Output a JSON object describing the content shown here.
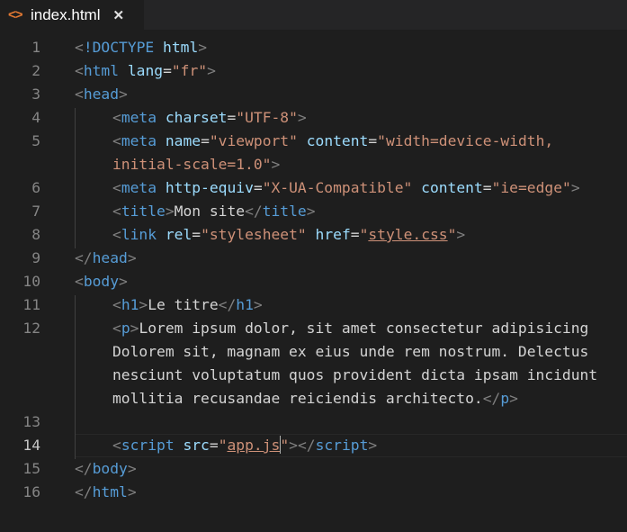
{
  "tab": {
    "icon": "code-brackets-icon",
    "icon_glyph": "<>",
    "filename": "index.html",
    "close_glyph": "✕"
  },
  "colors": {
    "background": "#1e1e1e",
    "tag": "#569cd6",
    "attribute": "#9cdcfe",
    "string": "#ce9178",
    "punctuation": "#808080",
    "text": "#d4d4d4",
    "line_number": "#858585",
    "file_icon": "#e37933"
  },
  "editor": {
    "active_line": "14",
    "lines": [
      {
        "num": "1",
        "indent": 0,
        "tokens": [
          {
            "c": "p",
            "v": "<"
          },
          {
            "c": "t",
            "v": "!DOCTYPE"
          },
          {
            "c": "x",
            "v": " "
          },
          {
            "c": "a",
            "v": "html"
          },
          {
            "c": "p",
            "v": ">"
          }
        ]
      },
      {
        "num": "2",
        "indent": 0,
        "tokens": [
          {
            "c": "p",
            "v": "<"
          },
          {
            "c": "t",
            "v": "html"
          },
          {
            "c": "x",
            "v": " "
          },
          {
            "c": "a",
            "v": "lang"
          },
          {
            "c": "x",
            "v": "="
          },
          {
            "c": "s",
            "v": "\"fr\""
          },
          {
            "c": "p",
            "v": ">"
          }
        ]
      },
      {
        "num": "3",
        "indent": 0,
        "tokens": [
          {
            "c": "p",
            "v": "<"
          },
          {
            "c": "t",
            "v": "head"
          },
          {
            "c": "p",
            "v": ">"
          }
        ]
      },
      {
        "num": "4",
        "indent": 1,
        "tokens": [
          {
            "c": "p",
            "v": "<"
          },
          {
            "c": "t",
            "v": "meta"
          },
          {
            "c": "x",
            "v": " "
          },
          {
            "c": "a",
            "v": "charset"
          },
          {
            "c": "x",
            "v": "="
          },
          {
            "c": "s",
            "v": "\"UTF-8\""
          },
          {
            "c": "p",
            "v": ">"
          }
        ]
      },
      {
        "num": "5",
        "indent": 1,
        "tokens": [
          {
            "c": "p",
            "v": "<"
          },
          {
            "c": "t",
            "v": "meta"
          },
          {
            "c": "x",
            "v": " "
          },
          {
            "c": "a",
            "v": "name"
          },
          {
            "c": "x",
            "v": "="
          },
          {
            "c": "s",
            "v": "\"viewport\""
          },
          {
            "c": "x",
            "v": " "
          },
          {
            "c": "a",
            "v": "content"
          },
          {
            "c": "x",
            "v": "="
          },
          {
            "c": "s",
            "v": "\"width=device-width,"
          }
        ]
      },
      {
        "num": "",
        "indent": 1,
        "tokens": [
          {
            "c": "s",
            "v": "initial-scale=1.0\""
          },
          {
            "c": "p",
            "v": ">"
          }
        ]
      },
      {
        "num": "6",
        "indent": 1,
        "tokens": [
          {
            "c": "p",
            "v": "<"
          },
          {
            "c": "t",
            "v": "meta"
          },
          {
            "c": "x",
            "v": " "
          },
          {
            "c": "a",
            "v": "http-equiv"
          },
          {
            "c": "x",
            "v": "="
          },
          {
            "c": "s",
            "v": "\"X-UA-Compatible\""
          },
          {
            "c": "x",
            "v": " "
          },
          {
            "c": "a",
            "v": "content"
          },
          {
            "c": "x",
            "v": "="
          },
          {
            "c": "s",
            "v": "\"ie=edge\""
          },
          {
            "c": "p",
            "v": ">"
          }
        ]
      },
      {
        "num": "7",
        "indent": 1,
        "tokens": [
          {
            "c": "p",
            "v": "<"
          },
          {
            "c": "t",
            "v": "title"
          },
          {
            "c": "p",
            "v": ">"
          },
          {
            "c": "x",
            "v": "Mon site"
          },
          {
            "c": "p",
            "v": "</"
          },
          {
            "c": "t",
            "v": "title"
          },
          {
            "c": "p",
            "v": ">"
          }
        ]
      },
      {
        "num": "8",
        "indent": 1,
        "tokens": [
          {
            "c": "p",
            "v": "<"
          },
          {
            "c": "t",
            "v": "link"
          },
          {
            "c": "x",
            "v": " "
          },
          {
            "c": "a",
            "v": "rel"
          },
          {
            "c": "x",
            "v": "="
          },
          {
            "c": "s",
            "v": "\"stylesheet\""
          },
          {
            "c": "x",
            "v": " "
          },
          {
            "c": "a",
            "v": "href"
          },
          {
            "c": "x",
            "v": "="
          },
          {
            "c": "s",
            "v": "\""
          },
          {
            "c": "s u",
            "v": "style.css"
          },
          {
            "c": "s",
            "v": "\""
          },
          {
            "c": "p",
            "v": ">"
          }
        ]
      },
      {
        "num": "9",
        "indent": 0,
        "tokens": [
          {
            "c": "p",
            "v": "</"
          },
          {
            "c": "t",
            "v": "head"
          },
          {
            "c": "p",
            "v": ">"
          }
        ]
      },
      {
        "num": "10",
        "indent": 0,
        "tokens": [
          {
            "c": "p",
            "v": "<"
          },
          {
            "c": "t",
            "v": "body"
          },
          {
            "c": "p",
            "v": ">"
          }
        ]
      },
      {
        "num": "11",
        "indent": 1,
        "tokens": [
          {
            "c": "p",
            "v": "<"
          },
          {
            "c": "t",
            "v": "h1"
          },
          {
            "c": "p",
            "v": ">"
          },
          {
            "c": "x",
            "v": "Le titre"
          },
          {
            "c": "p",
            "v": "</"
          },
          {
            "c": "t",
            "v": "h1"
          },
          {
            "c": "p",
            "v": ">"
          }
        ]
      },
      {
        "num": "12",
        "indent": 1,
        "tokens": [
          {
            "c": "p",
            "v": "<"
          },
          {
            "c": "t",
            "v": "p"
          },
          {
            "c": "p",
            "v": ">"
          },
          {
            "c": "x",
            "v": "Lorem ipsum dolor, sit amet consectetur adipisicing"
          }
        ]
      },
      {
        "num": "",
        "indent": 1,
        "tokens": [
          {
            "c": "x",
            "v": "Dolorem sit, magnam ex eius unde rem nostrum. Delectus"
          }
        ]
      },
      {
        "num": "",
        "indent": 1,
        "tokens": [
          {
            "c": "x",
            "v": "nesciunt voluptatum quos provident dicta ipsam incidunt"
          }
        ]
      },
      {
        "num": "",
        "indent": 1,
        "tokens": [
          {
            "c": "x",
            "v": "mollitia recusandae reiciendis architecto."
          },
          {
            "c": "p",
            "v": "</"
          },
          {
            "c": "t",
            "v": "p"
          },
          {
            "c": "p",
            "v": ">"
          }
        ]
      },
      {
        "num": "13",
        "indent": 0,
        "tokens": []
      },
      {
        "num": "14",
        "indent": 1,
        "tokens": [
          {
            "c": "p",
            "v": "<"
          },
          {
            "c": "t",
            "v": "script"
          },
          {
            "c": "x",
            "v": " "
          },
          {
            "c": "a",
            "v": "src"
          },
          {
            "c": "x",
            "v": "="
          },
          {
            "c": "s",
            "v": "\""
          },
          {
            "c": "s u",
            "v": "app.js"
          },
          {
            "c": "cursor",
            "v": ""
          },
          {
            "c": "s",
            "v": "\""
          },
          {
            "c": "p",
            "v": "></"
          },
          {
            "c": "t",
            "v": "script"
          },
          {
            "c": "p",
            "v": ">"
          }
        ]
      },
      {
        "num": "15",
        "indent": 0,
        "tokens": [
          {
            "c": "p",
            "v": "</"
          },
          {
            "c": "t",
            "v": "body"
          },
          {
            "c": "p",
            "v": ">"
          }
        ]
      },
      {
        "num": "16",
        "indent": 0,
        "tokens": [
          {
            "c": "p",
            "v": "</"
          },
          {
            "c": "t",
            "v": "html"
          },
          {
            "c": "p",
            "v": ">"
          }
        ]
      }
    ]
  }
}
